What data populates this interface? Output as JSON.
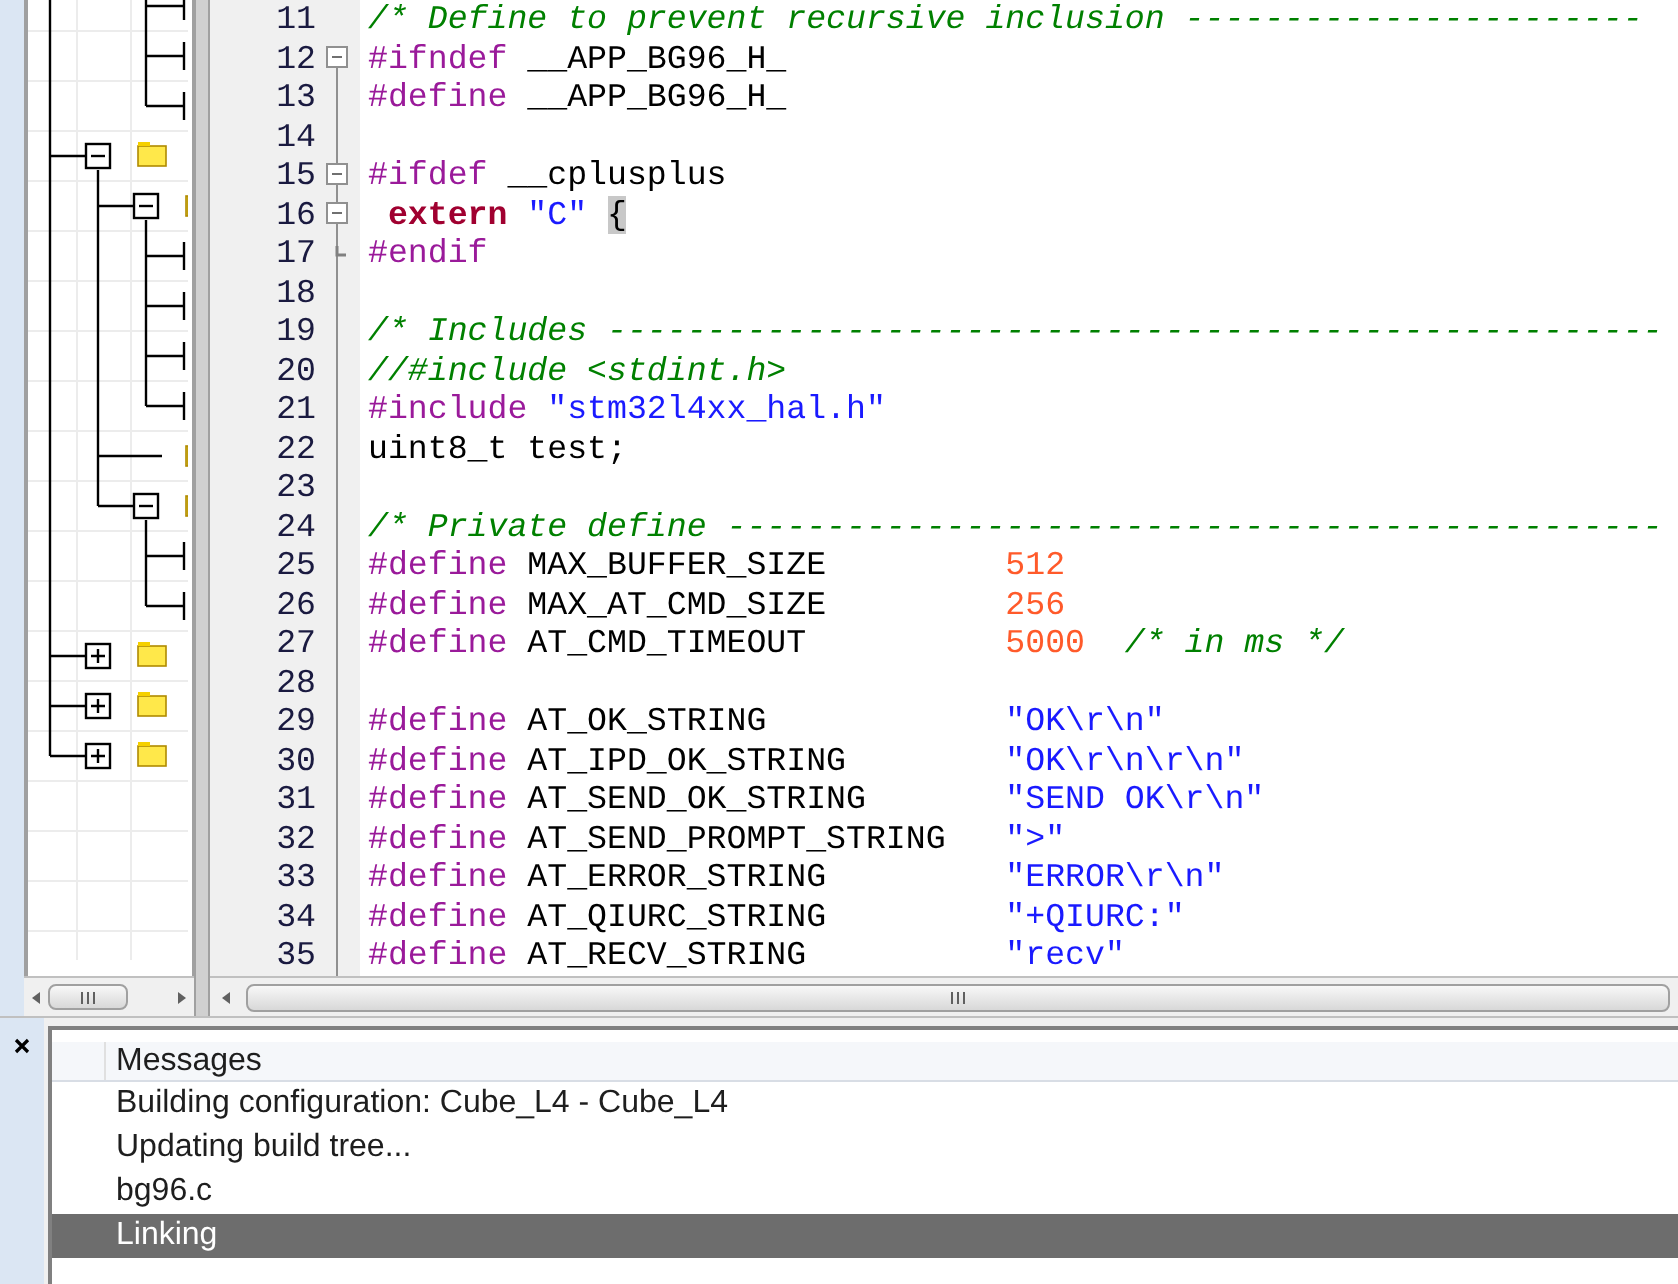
{
  "project_tree": {
    "continued": [
      {
        "kind": "leaf"
      },
      {
        "kind": "leaf"
      },
      {
        "kind": "leaf"
      }
    ],
    "nodes": [
      {
        "kind": "folder",
        "expanded": true,
        "children": [
          {
            "kind": "folder",
            "expanded": true,
            "children": [
              {
                "kind": "leaf"
              },
              {
                "kind": "leaf"
              },
              {
                "kind": "leaf"
              },
              {
                "kind": "leaf"
              }
            ]
          },
          {
            "kind": "folder"
          },
          {
            "kind": "folder",
            "expanded": true,
            "children": [
              {
                "kind": "leaf"
              },
              {
                "kind": "leaf"
              }
            ]
          }
        ]
      },
      {
        "kind": "folder",
        "expanded": false
      },
      {
        "kind": "folder",
        "expanded": false
      },
      {
        "kind": "folder",
        "expanded": false
      }
    ]
  },
  "editor": {
    "lines": [
      {
        "number": "11",
        "fold_start": false,
        "fold_end": false,
        "tokens": [
          {
            "kind": "comment",
            "text": "/* Define to prevent recursive inclusion -----------------------"
          }
        ]
      },
      {
        "number": "12",
        "fold_start": true,
        "fold_end": false,
        "tokens": [
          {
            "kind": "preprocessor",
            "text": "#ifndef"
          },
          {
            "kind": "plain",
            "text": " __APP_BG96_H_"
          }
        ]
      },
      {
        "number": "13",
        "fold_start": false,
        "fold_end": false,
        "tokens": [
          {
            "kind": "preprocessor",
            "text": "#define"
          },
          {
            "kind": "plain",
            "text": " __APP_BG96_H_"
          }
        ]
      },
      {
        "number": "14",
        "fold_start": false,
        "fold_end": false
      },
      {
        "number": "15",
        "fold_start": true,
        "fold_end": false,
        "tokens": [
          {
            "kind": "preprocessor",
            "text": "#ifdef"
          },
          {
            "kind": "plain",
            "text": " __cplusplus"
          }
        ]
      },
      {
        "number": "16",
        "fold_start": true,
        "fold_end": false,
        "tokens": [
          {
            "kind": "keyword",
            "text": " extern"
          },
          {
            "kind": "string",
            "text": " \"C\" "
          },
          {
            "kind": "match",
            "text": "{"
          }
        ]
      },
      {
        "number": "17",
        "fold_start": false,
        "fold_end": true,
        "tokens": [
          {
            "kind": "preprocessor",
            "text": "#endif"
          }
        ]
      },
      {
        "number": "18",
        "fold_start": false,
        "fold_end": false
      },
      {
        "number": "19",
        "fold_start": false,
        "fold_end": false,
        "tokens": [
          {
            "kind": "comment",
            "text": "/* Includes -----------------------------------------------------"
          }
        ]
      },
      {
        "number": "20",
        "fold_start": false,
        "fold_end": false,
        "tokens": [
          {
            "kind": "comment",
            "text": "//#include <stdint.h>"
          }
        ]
      },
      {
        "number": "21",
        "fold_start": false,
        "fold_end": false,
        "tokens": [
          {
            "kind": "preprocessor",
            "text": "#include"
          },
          {
            "kind": "string",
            "text": " \"stm32l4xx_hal.h\""
          }
        ]
      },
      {
        "number": "22",
        "fold_start": false,
        "fold_end": false,
        "tokens": [
          {
            "kind": "plain",
            "text": "uint8_t test;"
          }
        ]
      },
      {
        "number": "23",
        "fold_start": false,
        "fold_end": false
      },
      {
        "number": "24",
        "fold_start": false,
        "fold_end": false,
        "tokens": [
          {
            "kind": "comment",
            "text": "/* Private define -----------------------------------------------"
          }
        ]
      },
      {
        "number": "25",
        "fold_start": false,
        "fold_end": false,
        "tokens": [
          {
            "kind": "preprocessor",
            "text": "#define"
          },
          {
            "kind": "plain",
            "text": " MAX_BUFFER_SIZE         "
          },
          {
            "kind": "number",
            "text": "512"
          }
        ]
      },
      {
        "number": "26",
        "fold_start": false,
        "fold_end": false,
        "tokens": [
          {
            "kind": "preprocessor",
            "text": "#define"
          },
          {
            "kind": "plain",
            "text": " MAX_AT_CMD_SIZE         "
          },
          {
            "kind": "number",
            "text": "256"
          }
        ]
      },
      {
        "number": "27",
        "fold_start": false,
        "fold_end": false,
        "tokens": [
          {
            "kind": "preprocessor",
            "text": "#define"
          },
          {
            "kind": "plain",
            "text": " AT_CMD_TIMEOUT          "
          },
          {
            "kind": "number",
            "text": "5000"
          },
          {
            "kind": "comment",
            "text": "  /* in ms */"
          }
        ]
      },
      {
        "number": "28",
        "fold_start": false,
        "fold_end": false
      },
      {
        "number": "29",
        "fold_start": false,
        "fold_end": false,
        "tokens": [
          {
            "kind": "preprocessor",
            "text": "#define"
          },
          {
            "kind": "plain",
            "text": " AT_OK_STRING            "
          },
          {
            "kind": "string",
            "text": "\"OK\\r\\n\""
          }
        ]
      },
      {
        "number": "30",
        "fold_start": false,
        "fold_end": false,
        "tokens": [
          {
            "kind": "preprocessor",
            "text": "#define"
          },
          {
            "kind": "plain",
            "text": " AT_IPD_OK_STRING        "
          },
          {
            "kind": "string",
            "text": "\"OK\\r\\n\\r\\n\""
          }
        ]
      },
      {
        "number": "31",
        "fold_start": false,
        "fold_end": false,
        "tokens": [
          {
            "kind": "preprocessor",
            "text": "#define"
          },
          {
            "kind": "plain",
            "text": " AT_SEND_OK_STRING       "
          },
          {
            "kind": "string",
            "text": "\"SEND OK\\r\\n\""
          }
        ]
      },
      {
        "number": "32",
        "fold_start": false,
        "fold_end": false,
        "tokens": [
          {
            "kind": "preprocessor",
            "text": "#define"
          },
          {
            "kind": "plain",
            "text": " AT_SEND_PROMPT_STRING   "
          },
          {
            "kind": "string",
            "text": "\">\""
          }
        ]
      },
      {
        "number": "33",
        "fold_start": false,
        "fold_end": false,
        "tokens": [
          {
            "kind": "preprocessor",
            "text": "#define"
          },
          {
            "kind": "plain",
            "text": " AT_ERROR_STRING         "
          },
          {
            "kind": "string",
            "text": "\"ERROR\\r\\n\""
          }
        ]
      },
      {
        "number": "34",
        "fold_start": false,
        "fold_end": false,
        "tokens": [
          {
            "kind": "preprocessor",
            "text": "#define"
          },
          {
            "kind": "plain",
            "text": " AT_QIURC_STRING         "
          },
          {
            "kind": "string",
            "text": "\"+QIURC:\""
          }
        ]
      },
      {
        "number": "35",
        "fold_start": false,
        "fold_end": false,
        "tokens": [
          {
            "kind": "preprocessor",
            "text": "#define"
          },
          {
            "kind": "plain",
            "text": " AT_RECV_STRING          "
          },
          {
            "kind": "string",
            "text": "\"recv\""
          }
        ]
      }
    ]
  },
  "messages": {
    "header": "Messages",
    "rows": [
      {
        "text": "Building configuration: Cube_L4 - Cube_L4",
        "selected": false
      },
      {
        "text": "Updating build tree...",
        "selected": false
      },
      {
        "text": "bg96.c",
        "selected": false
      },
      {
        "text": "Linking",
        "selected": true
      }
    ]
  }
}
